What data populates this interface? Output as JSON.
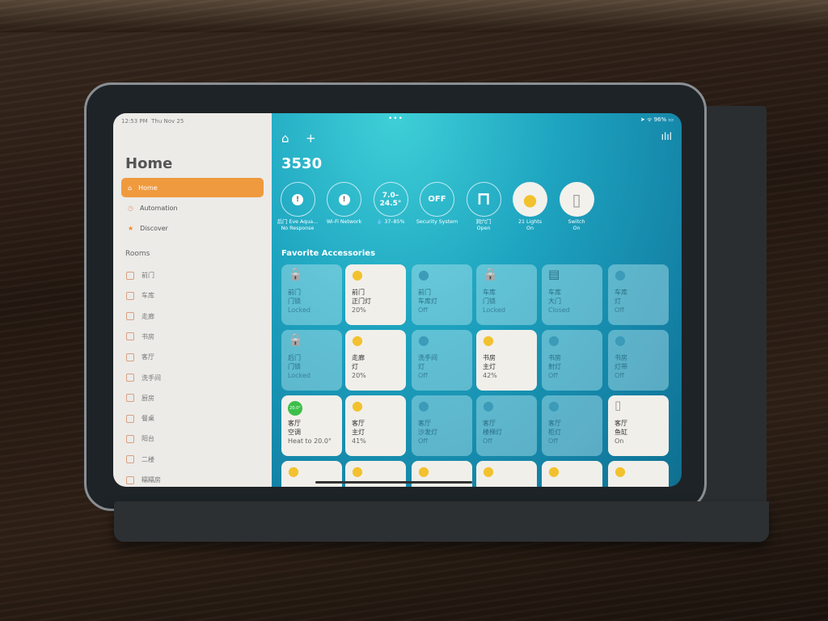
{
  "status_bar": {
    "time": "12:53 PM",
    "date": "Thu Nov 25",
    "battery": "96%"
  },
  "sidebar": {
    "title": "Home",
    "nav": [
      {
        "label": "Home",
        "icon": "house-icon",
        "active": true
      },
      {
        "label": "Automation",
        "icon": "clock-icon"
      },
      {
        "label": "Discover",
        "icon": "star-icon"
      }
    ],
    "rooms_label": "Rooms",
    "rooms": [
      "前门",
      "车库",
      "走廊",
      "书房",
      "客厅",
      "洗手间",
      "厨房",
      "餐桌",
      "阳台",
      "二楼",
      "糯糯房"
    ]
  },
  "main": {
    "home_name": "3530",
    "favorites_label": "Favorite Accessories",
    "status_chips": [
      {
        "icon": "!",
        "l1": "后门 Eve Aqua...",
        "l2": "No Response"
      },
      {
        "icon": "!",
        "l1": "Wi-Fi Network",
        "l2": ""
      },
      {
        "icon": "7.0–24.5°",
        "l1": "💧 37–85%",
        "l2": ""
      },
      {
        "icon": "OFF",
        "l1": "Security System",
        "l2": ""
      },
      {
        "icon": "door",
        "l1": "洞穴门",
        "l2": "Open"
      },
      {
        "icon": "bulb",
        "l1": "21 Lights",
        "l2": "On",
        "on": true
      },
      {
        "icon": "switch",
        "l1": "Switch",
        "l2": "On",
        "on": true
      }
    ],
    "tiles": [
      {
        "icon": "lock",
        "n1": "前门",
        "n2": "门锁",
        "state": "Locked"
      },
      {
        "icon": "bulb",
        "n1": "前门",
        "n2": "正门灯",
        "state": "20%",
        "on": true
      },
      {
        "icon": "bulb",
        "n1": "前门",
        "n2": "车库灯",
        "state": "Off"
      },
      {
        "icon": "lock",
        "n1": "车库",
        "n2": "门锁",
        "state": "Locked"
      },
      {
        "icon": "garage",
        "n1": "车库",
        "n2": "大门",
        "state": "Closed"
      },
      {
        "icon": "bulb",
        "n1": "车库",
        "n2": "灯",
        "state": "Off"
      },
      {
        "icon": "lock",
        "n1": "后门",
        "n2": "门锁",
        "state": "Locked"
      },
      {
        "icon": "bulb",
        "n1": "走廊",
        "n2": "灯",
        "state": "20%",
        "on": true
      },
      {
        "icon": "bulb",
        "n1": "洗手间",
        "n2": "灯",
        "state": "Off"
      },
      {
        "icon": "bulb",
        "n1": "书房",
        "n2": "主灯",
        "state": "42%",
        "on": true
      },
      {
        "icon": "bulb",
        "n1": "书房",
        "n2": "射灯",
        "state": "Off"
      },
      {
        "icon": "bulb",
        "n1": "书房",
        "n2": "灯带",
        "state": "Off"
      },
      {
        "icon": "thermostat",
        "badge": "20.0°",
        "n1": "客厅",
        "n2": "空调",
        "state": "Heat to 20.0°",
        "on": true
      },
      {
        "icon": "bulb",
        "n1": "客厅",
        "n2": "主灯",
        "state": "41%",
        "on": true
      },
      {
        "icon": "bulb",
        "n1": "客厅",
        "n2": "沙发灯",
        "state": "Off"
      },
      {
        "icon": "bulb",
        "n1": "客厅",
        "n2": "楼梯灯",
        "state": "Off"
      },
      {
        "icon": "bulb",
        "n1": "客厅",
        "n2": "柜灯",
        "state": "Off"
      },
      {
        "icon": "switch",
        "n1": "客厅",
        "n2": "鱼缸",
        "state": "On",
        "on": true
      },
      {
        "icon": "bulb",
        "on": true
      },
      {
        "icon": "bulb",
        "on": true
      },
      {
        "icon": "bulb",
        "on": true
      },
      {
        "icon": "bulb",
        "on": true
      },
      {
        "icon": "bulb",
        "on": true
      },
      {
        "icon": "bulb",
        "on": true
      }
    ]
  },
  "colors": {
    "accent": "#ef9a3e",
    "bulb_on": "#f2c12e",
    "bulb_off": "#3b9bb8"
  }
}
